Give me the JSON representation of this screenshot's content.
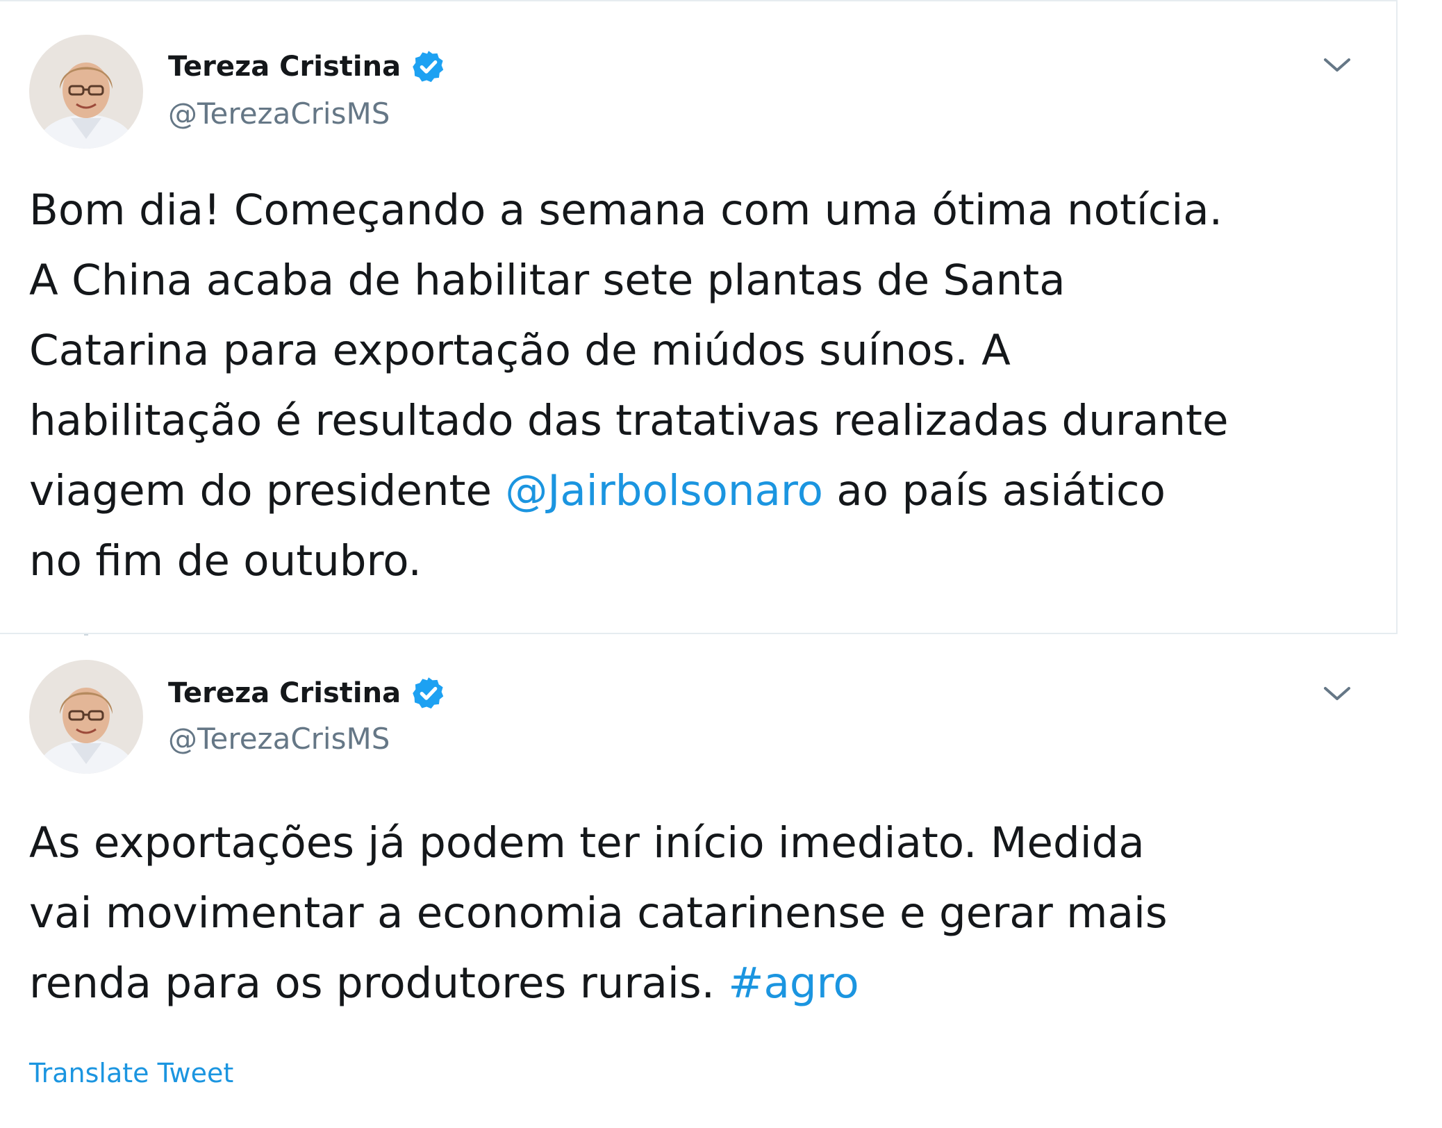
{
  "colors": {
    "link": "#1b95e0",
    "secondary_text": "#657786",
    "primary_text": "#14171a",
    "border": "#e6ecf0",
    "verified_badge": "#1da1f2"
  },
  "tweets": [
    {
      "display_name": "Tereza Cristina",
      "handle": "@TerezaCrisMS",
      "verified_icon": "verified-badge-icon",
      "menu_icon": "chevron-down-icon",
      "text": {
        "line1": "Bom dia! Começando a semana com uma ótima notícia.",
        "line2": "A China acaba de habilitar sete plantas de Santa",
        "line3": "Catarina para exportação de miúdos suínos. A",
        "line4": "habilitação é resultado das tratativas realizadas durante",
        "line5_before": "viagem do presidente ",
        "line5_mention": "@Jairbolsonaro",
        "line5_after": " ao país asiático",
        "line6": "no fim de outubro."
      }
    },
    {
      "display_name": "Tereza Cristina",
      "handle": "@TerezaCrisMS",
      "verified_icon": "verified-badge-icon",
      "menu_icon": "chevron-down-icon",
      "text": {
        "line1": "As exportações já podem ter início imediato. Medida",
        "line2": "vai movimentar a economia catarinense e gerar mais",
        "line3_before": "renda para os produtores rurais. ",
        "line3_hashtag": "#agro"
      },
      "translate_label": "Translate Tweet"
    }
  ]
}
